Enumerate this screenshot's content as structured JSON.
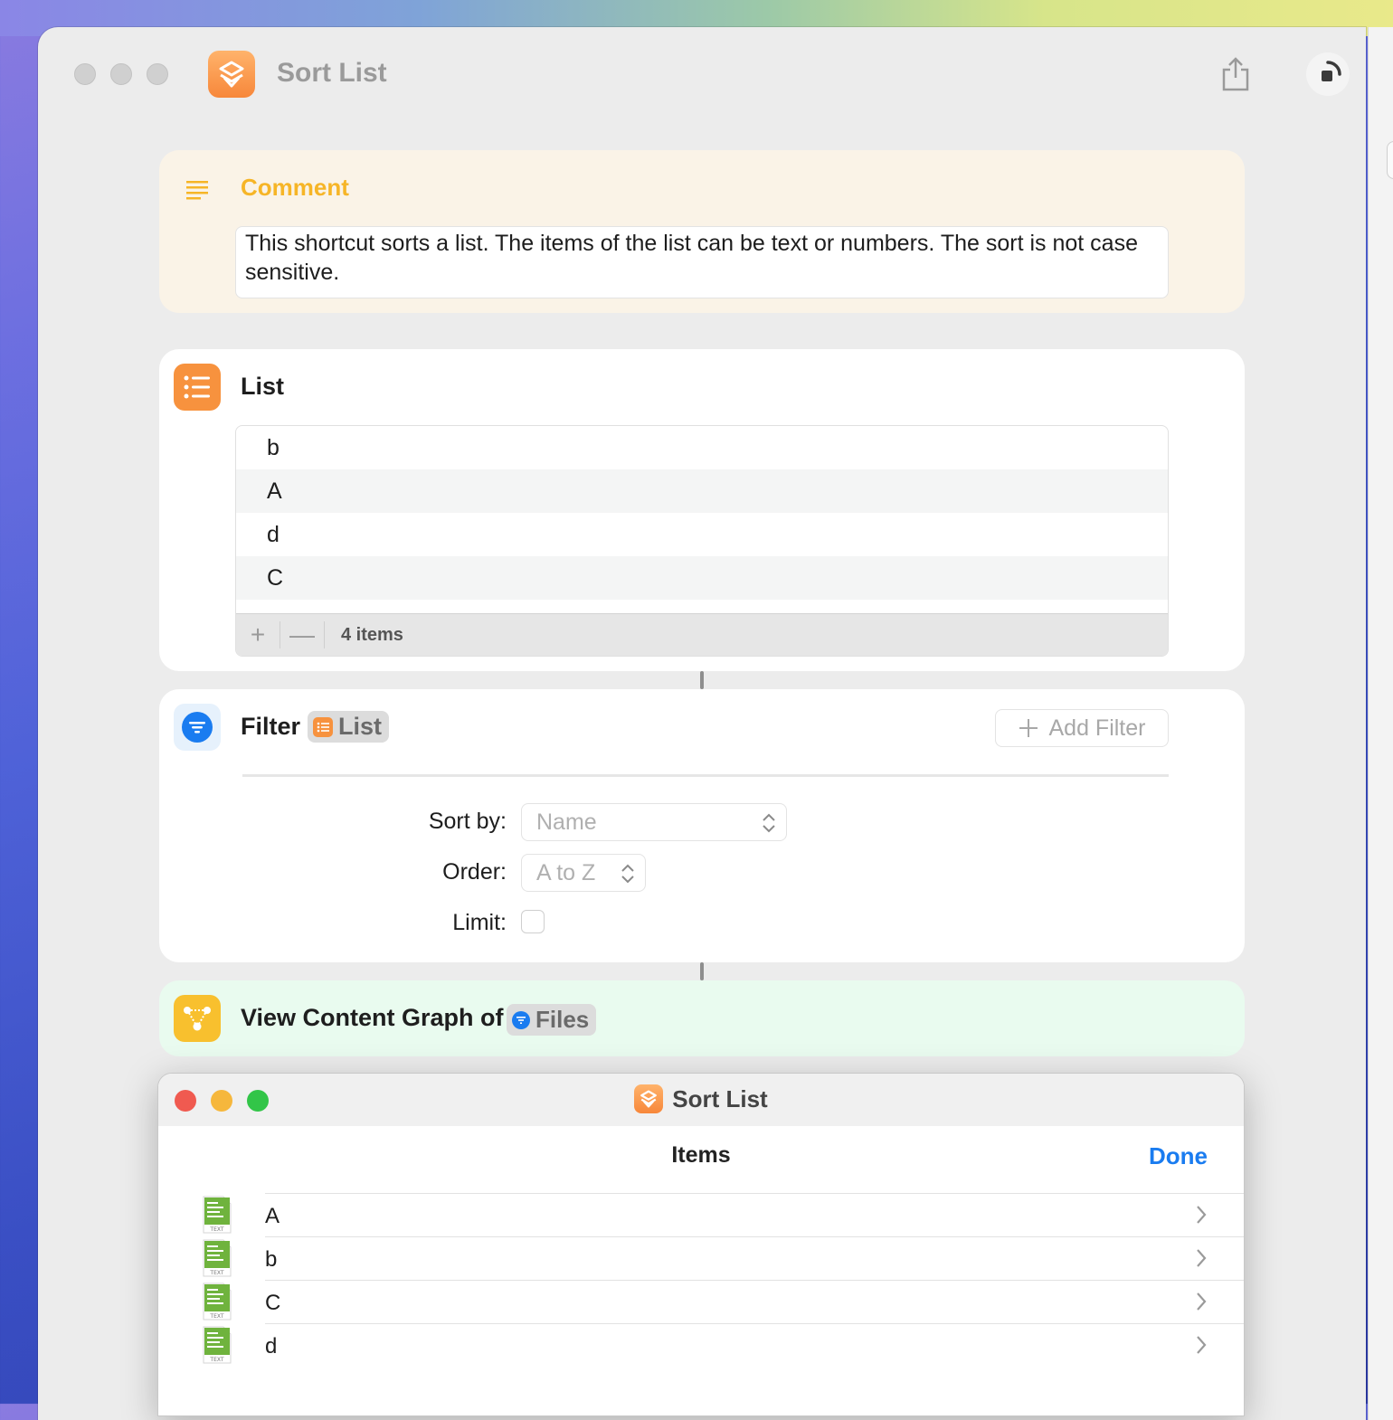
{
  "window": {
    "title": "Sort List"
  },
  "comment": {
    "title": "Comment",
    "text": "This shortcut sorts a list. The items of the list can be text or numbers. The sort is not case sensitive."
  },
  "list_action": {
    "title": "List",
    "items": [
      "b",
      "A",
      "d",
      "C"
    ],
    "add_symbol": "+",
    "remove_symbol": "—",
    "count": "4 items"
  },
  "filter_action": {
    "title": "Filter",
    "input": "List",
    "add_filter": "Add Filter",
    "sort_by_label": "Sort by:",
    "sort_by_value": "Name",
    "order_label": "Order:",
    "order_value": "A to Z",
    "limit_label": "Limit:"
  },
  "graph_action": {
    "title": "View Content Graph of",
    "input": "Files"
  },
  "popup": {
    "title": "Sort List",
    "header": "Items",
    "done": "Done",
    "items": [
      "A",
      "b",
      "C",
      "d"
    ],
    "file_badge": "TEXT"
  },
  "colors": {
    "comment_accent": "#f6b527",
    "list_icon": "#f7923e",
    "filter_icon": "#1a7cf0",
    "graph_icon": "#f8c02e",
    "done_blue": "#1a7cf0",
    "close_red": "#f05a50",
    "minimize_yellow": "#f6b73c",
    "zoom_green": "#32c548"
  },
  "icons": {
    "app": "shortcuts-icon",
    "share": "share-icon",
    "run": "run-stop-icon",
    "comment": "comment-lines-icon",
    "list": "list-icon",
    "filter": "filter-icon",
    "graph": "content-graph-icon",
    "file": "text-file-icon",
    "chevron": "chevron-right-icon"
  }
}
